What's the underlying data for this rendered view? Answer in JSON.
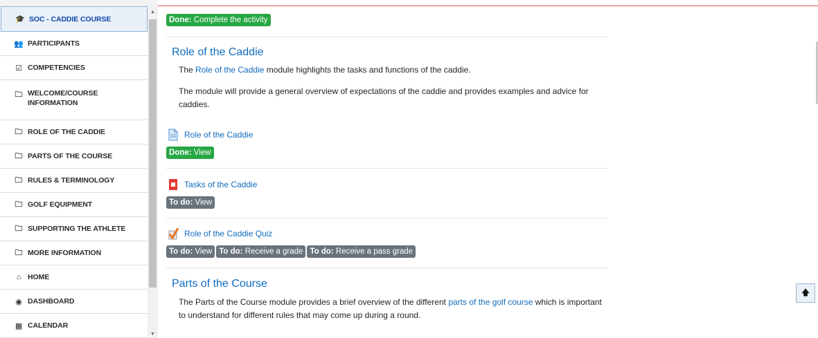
{
  "sidebar": {
    "items": [
      {
        "label": "SOC - CADDIE COURSE",
        "icon": "graduation-cap-icon"
      },
      {
        "label": "PARTICIPANTS",
        "icon": "users-icon"
      },
      {
        "label": "COMPETENCIES",
        "icon": "checkbox-icon"
      },
      {
        "label": "WELCOME/COURSE INFORMATION",
        "icon": "folder-icon"
      },
      {
        "label": "ROLE OF THE CADDIE",
        "icon": "folder-icon"
      },
      {
        "label": "PARTS OF THE COURSE",
        "icon": "folder-icon"
      },
      {
        "label": "RULES & TERMINOLOGY",
        "icon": "folder-icon"
      },
      {
        "label": "GOLF EQUIPMENT",
        "icon": "folder-icon"
      },
      {
        "label": "SUPPORTING THE ATHLETE",
        "icon": "folder-icon"
      },
      {
        "label": "MORE INFORMATION",
        "icon": "folder-icon"
      },
      {
        "label": "HOME",
        "icon": "home-icon"
      },
      {
        "label": "DASHBOARD",
        "icon": "dashboard-icon"
      },
      {
        "label": "CALENDAR",
        "icon": "calendar-icon"
      }
    ]
  },
  "main": {
    "top_badge": {
      "prefix": "Done:",
      "text": "Complete the activity"
    },
    "role_section": {
      "title": "Role of the Caddie",
      "para1_pre": "The ",
      "para1_link": "Role of the Caddie",
      "para1_post": " module highlights the tasks and functions of the caddie.",
      "para2": "The module will provide a general overview of expectations of the caddie and provides examples and advice for caddies."
    },
    "activities": [
      {
        "name": "Role of the Caddie",
        "icon": "page-icon",
        "badges": [
          {
            "status": "Done:",
            "text": "View",
            "type": "done"
          }
        ]
      },
      {
        "name": "Tasks of the Caddie",
        "icon": "pdf-icon",
        "badges": [
          {
            "status": "To do:",
            "text": "View",
            "type": "todo"
          }
        ]
      },
      {
        "name": "Role of the Caddie Quiz",
        "icon": "quiz-icon",
        "badges": [
          {
            "status": "To do:",
            "text": "View",
            "type": "todo"
          },
          {
            "status": "To do:",
            "text": "Receive a grade",
            "type": "todo"
          },
          {
            "status": "To do:",
            "text": "Receive a pass grade",
            "type": "todo"
          }
        ]
      }
    ],
    "parts_section": {
      "title": "Parts of the Course",
      "para_pre": "The Parts of the Course module provides a brief overview of the different ",
      "para_link": "parts of the golf course",
      "para_post": " which is important to understand for different rules that may come up during a round."
    }
  },
  "colors": {
    "link": "#0f6cbf",
    "done": "#28a745",
    "todo": "#6a737b"
  }
}
